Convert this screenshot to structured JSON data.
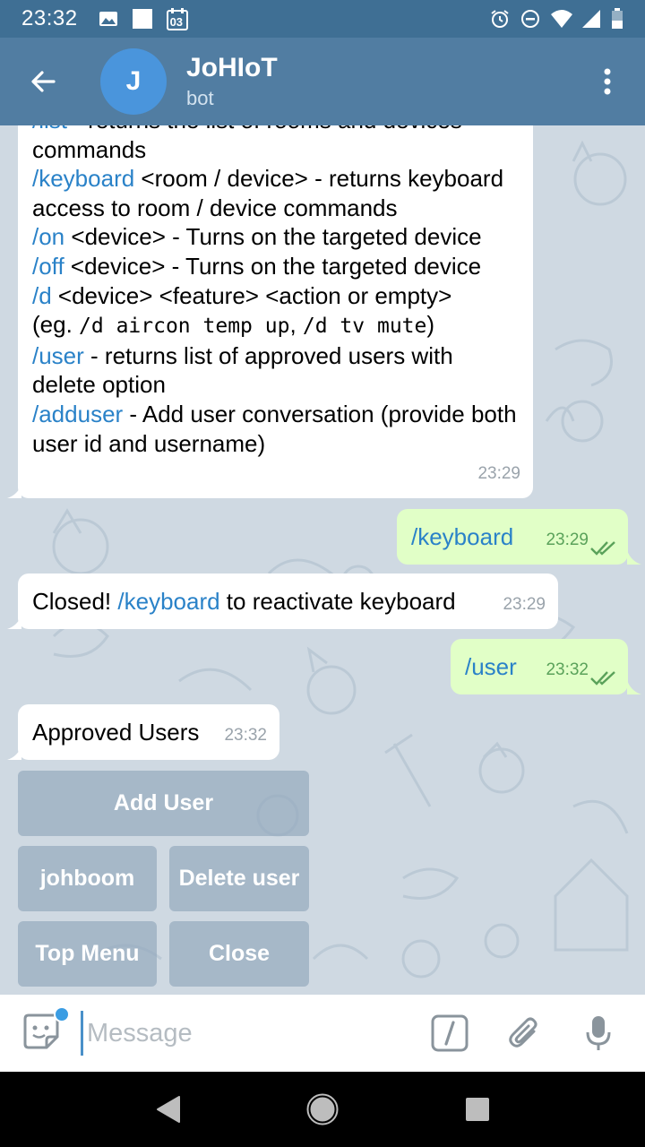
{
  "status_bar": {
    "time": "23:32",
    "calendar_badge": "03"
  },
  "header": {
    "avatar_letter": "J",
    "title": "JoHIoT",
    "subtitle": "bot"
  },
  "messages": {
    "help": {
      "partial_line_cmd": "/list",
      "partial_line_text": " - returns the list of rooms and devices",
      "line_commands": "commands",
      "keyboard_cmd": "/keyboard",
      "keyboard_text": " <room / device> - returns keyboard access to room / device commands",
      "on_cmd": "/on",
      "on_text": " <device> - Turns on the targeted device",
      "off_cmd": "/off",
      "off_text": " <device> - Turns on the targeted device",
      "d_cmd": "/d",
      "d_text": " <device> <feature> <action or empty>",
      "eg_prefix": "(eg. ",
      "eg_code1": "/d aircon temp up",
      "eg_sep": ", ",
      "eg_code2": "/d tv mute",
      "eg_suffix": ")",
      "user_cmd": "/user",
      "user_text": " - returns list of approved users with delete option",
      "adduser_cmd": "/adduser",
      "adduser_text": " - Add user conversation (provide both user id and username)",
      "time": "23:29"
    },
    "out1": {
      "text": "/keyboard",
      "time": "23:29"
    },
    "closed": {
      "prefix": "Closed! ",
      "cmd": "/keyboard",
      "suffix": " to reactivate keyboard",
      "time": "23:29"
    },
    "out2": {
      "text": "/user",
      "time": "23:32"
    },
    "approved": {
      "text": "Approved Users",
      "time": "23:32"
    }
  },
  "keyboard": {
    "add_user": "Add User",
    "johboom": "johboom",
    "delete_user": "Delete user",
    "top_menu": "Top Menu",
    "close": "Close"
  },
  "input": {
    "placeholder": "Message"
  },
  "colors": {
    "header": "#517da2",
    "status_bar": "#3f6f94",
    "command_link": "#2a82c8",
    "outgoing_bubble": "#e1ffc7",
    "chat_background": "#cfd9e2"
  }
}
